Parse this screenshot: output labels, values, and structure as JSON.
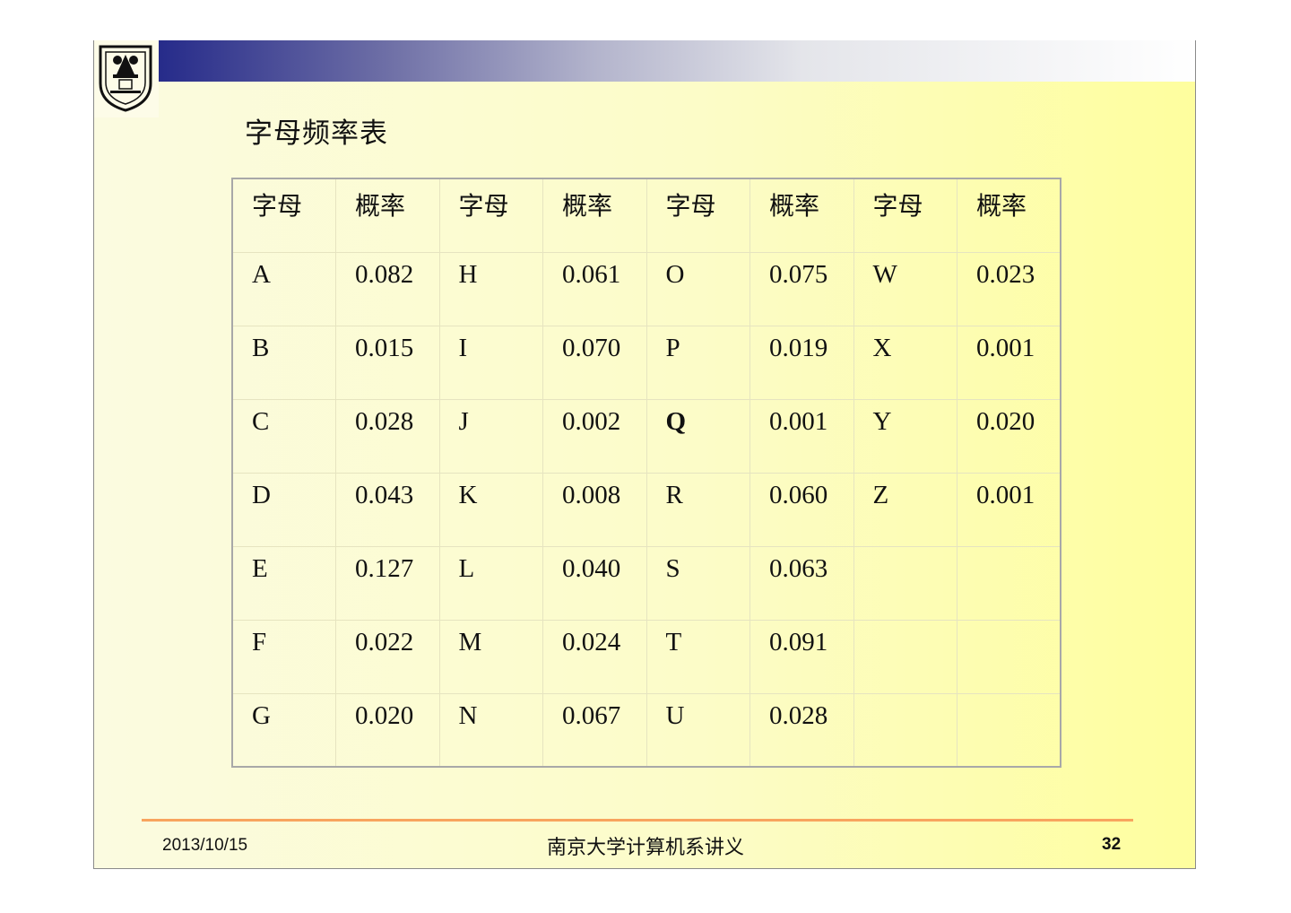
{
  "slide": {
    "title": "字母频率表",
    "header_labels": [
      "字母",
      "概率",
      "字母",
      "概率",
      "字母",
      "概率",
      "字母",
      "概率"
    ],
    "rows": [
      [
        "A",
        "0.082",
        "H",
        "0.061",
        "O",
        "0.075",
        "W",
        "0.023"
      ],
      [
        "B",
        "0.015",
        "I",
        "0.070",
        "P",
        "0.019",
        "X",
        "0.001"
      ],
      [
        "C",
        "0.028",
        "J",
        "0.002",
        "Q",
        "0.001",
        "Y",
        "0.020"
      ],
      [
        "D",
        "0.043",
        "K",
        "0.008",
        "R",
        "0.060",
        "Z",
        "0.001"
      ],
      [
        "E",
        "0.127",
        "L",
        "0.040",
        "S",
        "0.063",
        "",
        ""
      ],
      [
        "F",
        "0.022",
        "M",
        "0.024",
        "T",
        "0.091",
        "",
        ""
      ],
      [
        "G",
        "0.020",
        "N",
        "0.067",
        "U",
        "0.028",
        "",
        ""
      ]
    ]
  },
  "footer": {
    "date": "2013/10/15",
    "center_text": "南京大学计算机系讲义",
    "page_number": "32"
  },
  "colors": {
    "band_start": "#262b8a",
    "footer_line": "#f8a45e",
    "slide_bg": "#fcfcc8"
  },
  "icons": {
    "logo": "university-emblem-icon"
  }
}
